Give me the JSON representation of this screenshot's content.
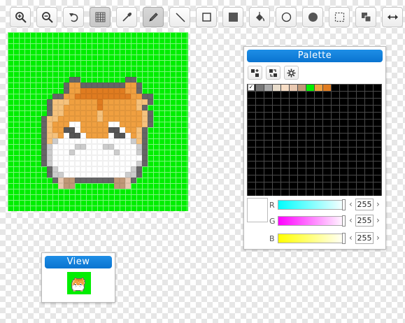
{
  "toolbar": {
    "tools": [
      {
        "name": "zoom-in",
        "icon": "zoom-in-icon"
      },
      {
        "name": "zoom-out",
        "icon": "zoom-out-icon"
      },
      {
        "name": "undo",
        "icon": "undo-icon"
      },
      {
        "name": "grid",
        "icon": "grid-icon",
        "active": true
      },
      {
        "name": "eyedropper",
        "icon": "eyedropper-icon"
      },
      {
        "name": "pencil",
        "icon": "pencil-icon",
        "active": true
      },
      {
        "name": "line",
        "icon": "line-icon"
      },
      {
        "name": "rectangle",
        "icon": "rectangle-outline-icon"
      },
      {
        "name": "filled-rectangle",
        "icon": "rectangle-filled-icon"
      },
      {
        "name": "fill",
        "icon": "paint-bucket-icon"
      },
      {
        "name": "ellipse",
        "icon": "ellipse-outline-icon"
      },
      {
        "name": "filled-ellipse",
        "icon": "ellipse-filled-icon"
      },
      {
        "name": "select",
        "icon": "selection-icon"
      },
      {
        "name": "copy",
        "icon": "copy-icon"
      },
      {
        "name": "move",
        "icon": "move-horizontal-icon"
      }
    ]
  },
  "canvas": {
    "background": "#00ee00",
    "colors": {
      "d": "#666666",
      "o": "#f0a040",
      "O": "#e07c20",
      "l": "#f6c27c",
      "w": "#ffffff",
      "g": "#cccccc",
      "k": "#555555",
      "p": "#e8c8b0",
      "b": "#c09878"
    },
    "rows": [
      "",
      "",
      "",
      "",
      "",
      "",
      "",
      "",
      "           dd        dd",
      "          dooddddddddood",
      "          dooOOOOOOOOood",
      "        ddooOOOOOOOOOOoodd",
      "       dllloooooOoooooolld",
      "       dllooooooOoooooold",
      "       dlloooooolooooooold",
      "      dllooooooolooooooold",
      "      dlooowwooooowwoooold",
      "      dlookkwoooookkwoold",
      "      dllowkkwoooowkkwold",
      "      dlgwwwwwwwwwwwwwgld",
      "      dgwwwwggwwwggwwwwgd",
      "      dgwwwgwwwwwwwgwwwgd",
      "      dgwwwwwwwwwwwwwwwwd",
      "      dgwwwwwwwwwwwwwwwgd",
      "       dgwwwwwwwwwwwwwgd",
      "       dggwwwwwwwwwwwggd",
      "        dpbbdddddddbbpd",
      "         pbb       bbp"
    ]
  },
  "palette": {
    "title": "Palette",
    "buttons": [
      {
        "name": "palette-add-button",
        "icon": "palette-add-icon"
      },
      {
        "name": "palette-replace-button",
        "icon": "palette-replace-icon"
      },
      {
        "name": "palette-settings-button",
        "icon": "gear-icon"
      }
    ],
    "swatches": [
      "#777777",
      "#aaaaaa",
      "#e8dccb",
      "#f6dcc4",
      "#e8c8b0",
      "#c09878",
      "#00ee00",
      "#f0a040",
      "#e07c20"
    ],
    "selected_color": "#ffffff",
    "channels": [
      {
        "label": "R",
        "value": "255",
        "gradient": "linear-gradient(to right,#00ffff,#ffffff)"
      },
      {
        "label": "G",
        "value": "255",
        "gradient": "linear-gradient(to right,#ff00ff,#ffffff)"
      },
      {
        "label": "B",
        "value": "255",
        "gradient": "linear-gradient(to right,#ffff00,#ffffff)"
      }
    ]
  },
  "view": {
    "title": "View"
  }
}
